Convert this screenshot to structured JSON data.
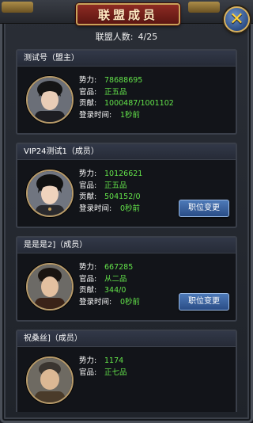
{
  "title": "联盟成员",
  "member_count": {
    "label": "联盟人数:",
    "value": "4/25"
  },
  "labels": {
    "power": "势力:",
    "rank": "官品:",
    "contribution": "贡献:",
    "login": "登录时间:"
  },
  "members": [
    {
      "header": "测试号（盟主）",
      "power": "78688695",
      "rank": "正五品",
      "contribution": "1000487/1001102",
      "login": "1秒前",
      "button": ""
    },
    {
      "header": "VIP24测试1（成员）",
      "power": "10126621",
      "rank": "正五品",
      "contribution": "504152/0",
      "login": "0秒前",
      "button": "职位变更"
    },
    {
      "header": "是是是2]（成员）",
      "power": "667285",
      "rank": "从二品",
      "contribution": "344/0",
      "login": "0秒前",
      "button": "职位变更"
    },
    {
      "header": "祝桑丝]（成员）",
      "power": "1174",
      "rank": "正七品",
      "contribution": "",
      "login": "",
      "button": ""
    }
  ],
  "colors": {
    "value_green": "#63e34a",
    "title_red": "#8e2b23",
    "button_blue": "#3a64a3",
    "close_gold": "#ffd23c"
  },
  "icons": {
    "close": "close-icon"
  }
}
